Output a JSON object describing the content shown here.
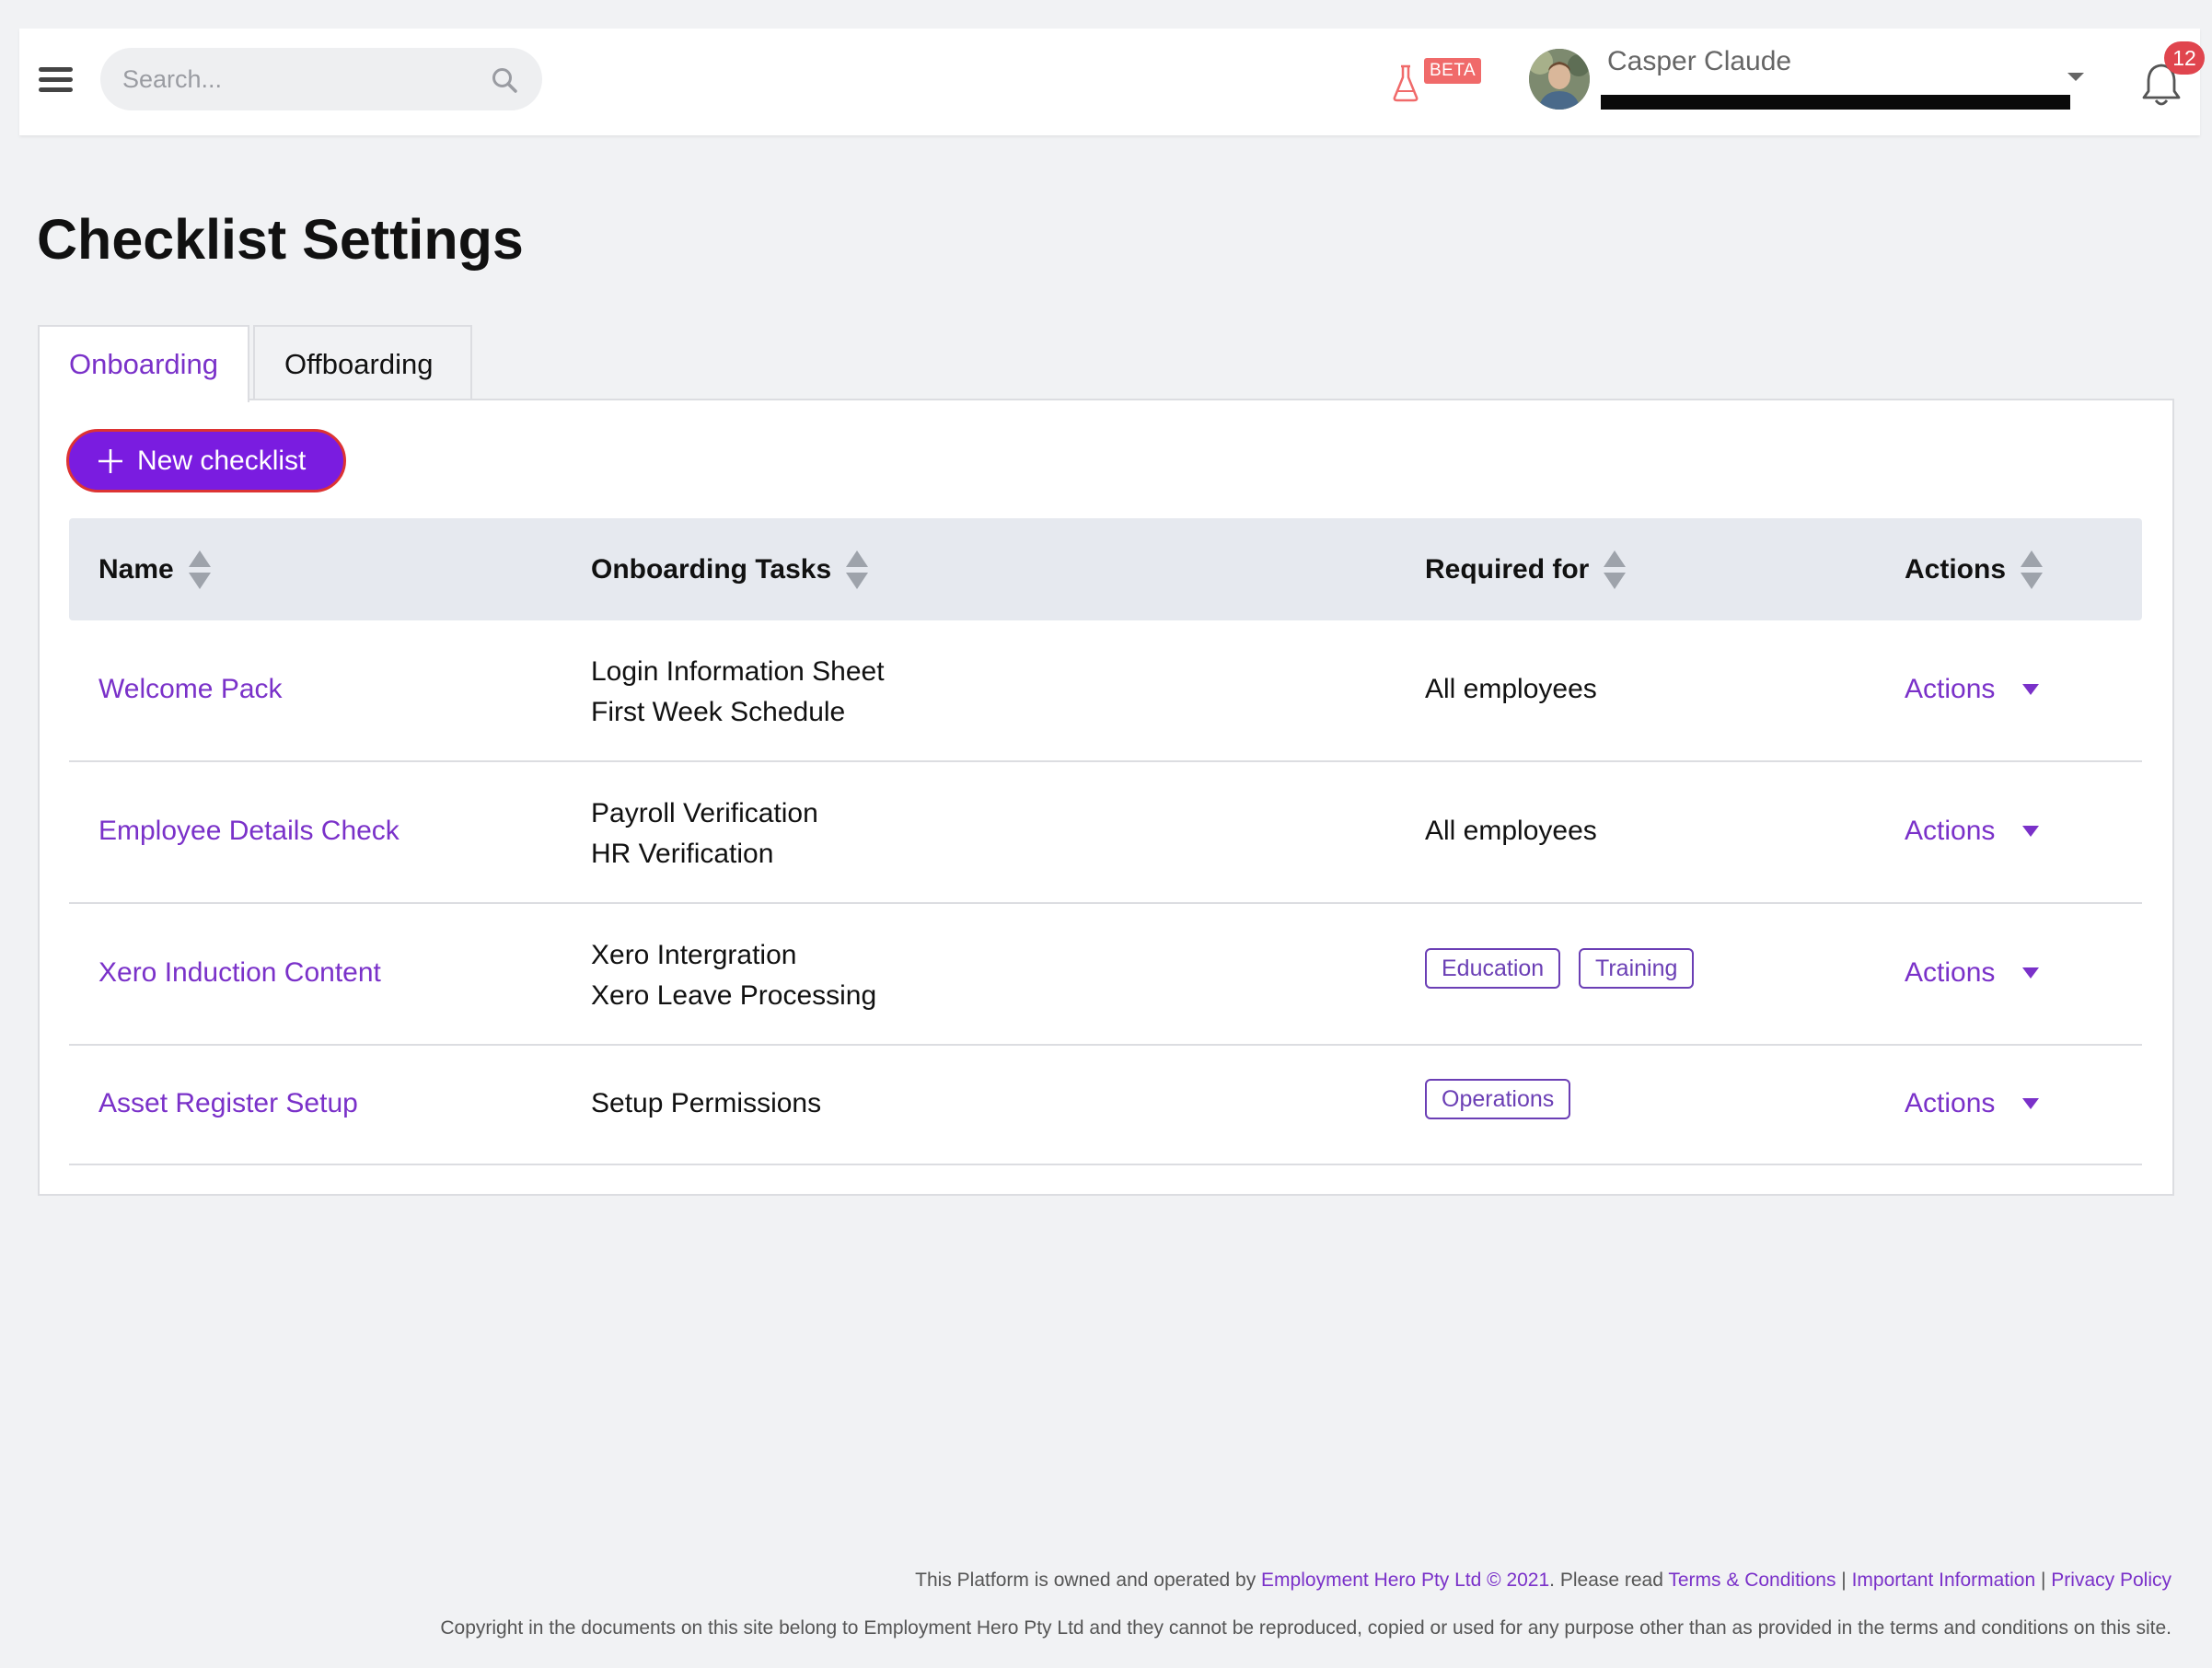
{
  "header": {
    "search_placeholder": "Search...",
    "beta_label": "BETA",
    "user_name": "Casper Claude",
    "notification_count": "12"
  },
  "page": {
    "title": "Checklist Settings"
  },
  "tabs": [
    {
      "label": "Onboarding",
      "active": true
    },
    {
      "label": "Offboarding",
      "active": false
    }
  ],
  "toolbar": {
    "new_checklist_label": "New checklist"
  },
  "table": {
    "columns": [
      "Name",
      "Onboarding Tasks",
      "Required for",
      "Actions"
    ],
    "rows": [
      {
        "name": "Welcome Pack",
        "tasks": [
          "Login Information Sheet",
          "First Week Schedule"
        ],
        "required_for": "All employees",
        "tags": [],
        "actions_label": "Actions"
      },
      {
        "name": "Employee Details Check",
        "tasks": [
          "Payroll Verification",
          "HR Verification"
        ],
        "required_for": "All employees",
        "tags": [],
        "actions_label": "Actions"
      },
      {
        "name": "Xero Induction Content",
        "tasks": [
          "Xero Intergration",
          "Xero Leave Processing"
        ],
        "required_for": "",
        "tags": [
          "Education",
          "Training"
        ],
        "actions_label": "Actions"
      },
      {
        "name": "Asset Register Setup",
        "tasks": [
          "Setup Permissions"
        ],
        "required_for": "",
        "tags": [
          "Operations"
        ],
        "actions_label": "Actions"
      }
    ]
  },
  "footer": {
    "line1_prefix": "This Platform is owned and operated by ",
    "company_link": "Employment Hero Pty Ltd © 2021",
    "line1_mid": ". Please read ",
    "terms_link": "Terms & Conditions",
    "sep": " | ",
    "important_link": "Important Information",
    "privacy_link": "Privacy Policy",
    "line2": "Copyright in the documents on this site belong to Employment Hero Pty Ltd and they cannot be reproduced, copied or used for any purpose other than as provided in the terms and conditions on this site."
  },
  "colors": {
    "accent": "#7a31c9",
    "button": "#7a1ce0",
    "badge": "#e0454e",
    "beta": "#f06a6a"
  }
}
